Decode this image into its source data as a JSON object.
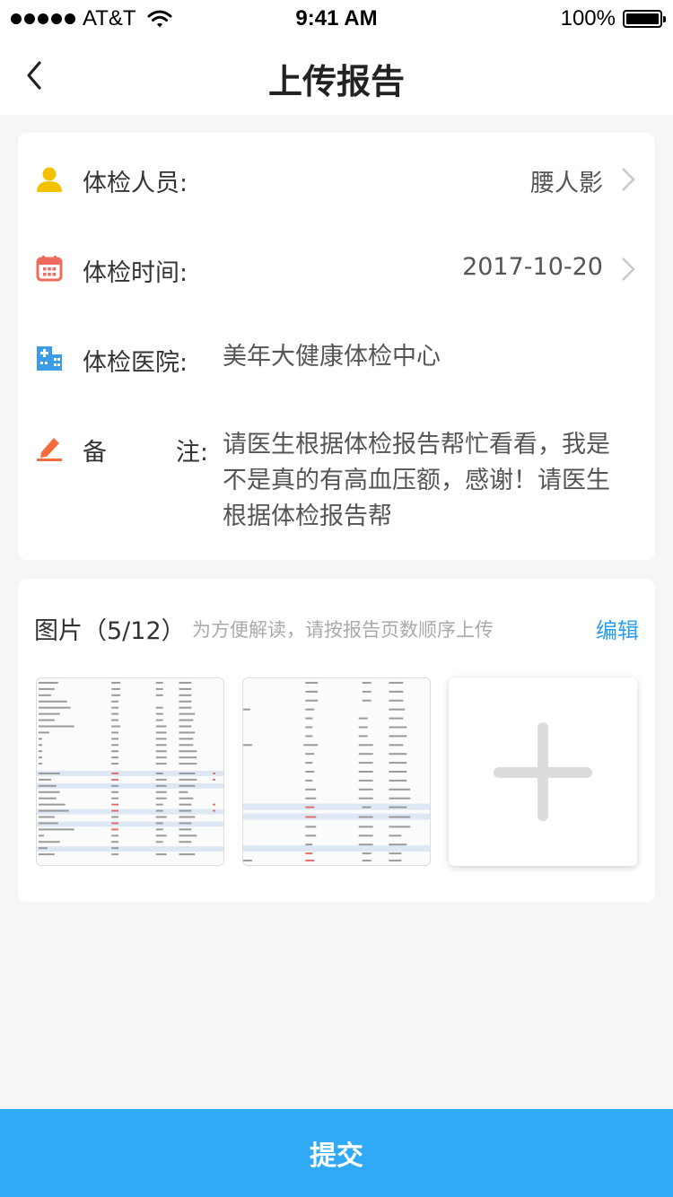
{
  "status_bar": {
    "carrier": "AT&T",
    "time": "9:41 AM",
    "battery": "100%"
  },
  "nav": {
    "title": "上传报告",
    "back_icon": "chevron-left-icon"
  },
  "info": {
    "person": {
      "icon": "user-icon",
      "label": "体检人员:",
      "value": "腰人影"
    },
    "date": {
      "icon": "calendar-icon",
      "label": "体检时间:",
      "value": "2017-10-20"
    },
    "hospital": {
      "icon": "hospital-icon",
      "label": "体检医院:",
      "value": "美年大健康体检中心"
    },
    "remark": {
      "icon": "pencil-icon",
      "label_a": "备",
      "label_b": "注:",
      "value": "请医生根据体检报告帮忙看看，我是不是真的有高血压额，感谢！请医生根据体检报告帮"
    }
  },
  "photos": {
    "title": "图片（5/12）",
    "hint": "为方便解读，请按报告页数顺序上传",
    "edit_label": "编辑",
    "add_icon": "plus-icon"
  },
  "colors": {
    "accent": "#31aaf6",
    "link": "#2a9ef2",
    "user_icon": "#f2c200",
    "calendar_icon": "#f06b5d",
    "hospital_icon": "#3b9de8",
    "pencil_icon": "#f46b3c"
  },
  "submit_label": "提交"
}
